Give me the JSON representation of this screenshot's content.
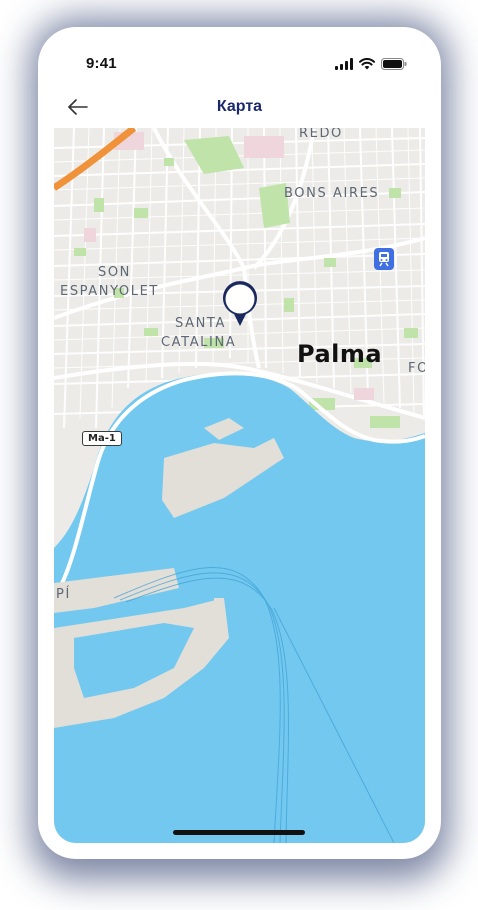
{
  "status_bar": {
    "time": "9:41",
    "signal_icon": "cellular-signal-icon",
    "wifi_icon": "wifi-icon",
    "battery_icon": "battery-icon"
  },
  "nav": {
    "back_icon": "arrow-left-icon",
    "title": "Карта"
  },
  "map": {
    "labels": {
      "redo": "REDO",
      "bons_aires": "BONS AIRES",
      "son": "SON",
      "espanyolet": "ESPANYOLET",
      "santa": "SANTA",
      "catalina": "CATALINA",
      "city": "Palma",
      "fo": "FO",
      "pi": "PÍ"
    },
    "road_shield": "Ma-1",
    "poi_icons": [
      "train-station-icon",
      "location-pin-icon"
    ],
    "colors": {
      "water": "#72c8ef",
      "land": "#ecebe7",
      "park": "#bfe3a8",
      "highway": "#f0923a",
      "pin": "#1a2a5e"
    }
  }
}
